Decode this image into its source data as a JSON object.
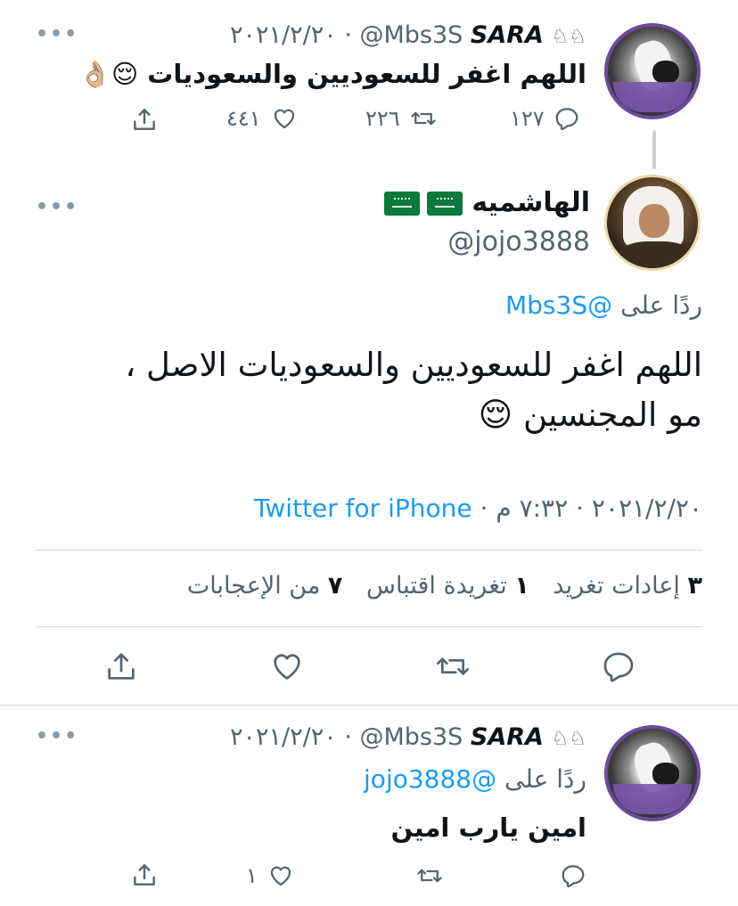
{
  "tweet1": {
    "name": "SARA",
    "name_emoji": "♘♘",
    "handle": "@Mbs3S",
    "date": "٢٠٢١/٢/٢٠",
    "text": "اللهم اغفر للسعوديين والسعوديات 😌👌🏼",
    "reply_count": "١٢٧",
    "retweet_count": "٢٢٦",
    "like_count": "٤٤١"
  },
  "main_tweet": {
    "name": "الهاشميه",
    "handle": "@jojo3888",
    "reply_prefix": "ردًا على",
    "reply_to": "@Mbs3S",
    "text_line1": "اللهم اغفر للسعوديين والسعوديات الاصل ،",
    "text_line2": "مو المجنسين 😌",
    "date": "٢٠٢١/٢/٢٠",
    "time": "٧:٣٢ م",
    "source": "Twitter for iPhone",
    "retweets_num": "٣",
    "retweets_label": "إعادات تغريد",
    "quotes_num": "١",
    "quotes_label": "تغريدة اقتباس",
    "likes_num": "٧",
    "likes_label": "من الإعجابات"
  },
  "tweet3": {
    "name": "SARA",
    "name_emoji": "♘♘",
    "handle": "@Mbs3S",
    "date": "٢٠٢١/٢/٢٠",
    "reply_prefix": "ردًا على",
    "reply_to": "@jojo3888",
    "text": "امين يارب امين",
    "like_count": "١"
  },
  "separator": "·",
  "colors": {
    "accent": "#1d9bf0",
    "muted": "#536471",
    "divider": "#cfd9de"
  }
}
